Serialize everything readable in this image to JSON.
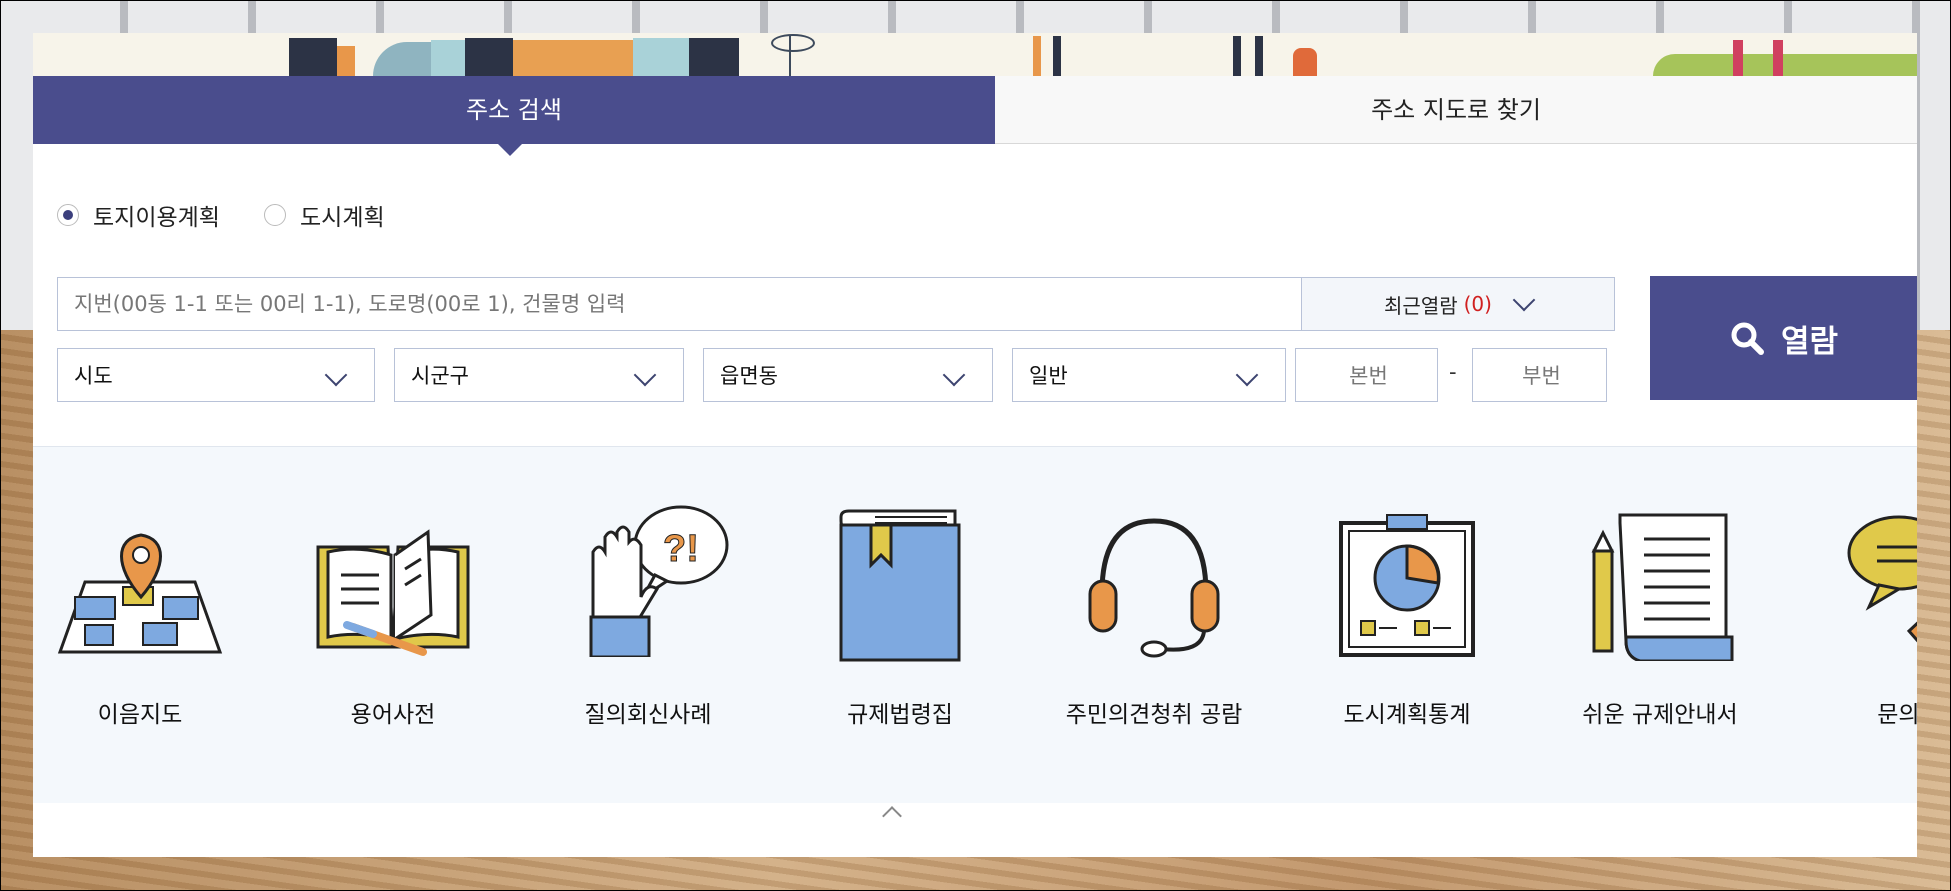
{
  "tabs": {
    "address_search": "주소 검색",
    "find_on_map": "주소 지도로 찾기"
  },
  "radio": {
    "land_use_plan": "토지이용계획",
    "city_plan": "도시계획",
    "selected": "토지이용계획"
  },
  "search": {
    "placeholder": "지번(00동 1-1 또는 00리 1-1), 도로명(00로 1), 건물명 입력",
    "value": ""
  },
  "recent": {
    "label": "최근열람",
    "count": "(0)"
  },
  "view_button": "열람",
  "selects": {
    "sido": "시도",
    "sigungu": "시군구",
    "eupmyeondong": "읍면동",
    "type": "일반"
  },
  "lot_number": {
    "main_placeholder": "본번",
    "separator": "-",
    "sub_placeholder": "부번"
  },
  "services": [
    {
      "label": "이음지도",
      "icon": "map-pin-icon"
    },
    {
      "label": "용어사전",
      "icon": "open-book-icon"
    },
    {
      "label": "질의회신사례",
      "icon": "hand-question-icon"
    },
    {
      "label": "규제법령집",
      "icon": "law-book-icon"
    },
    {
      "label": "주민의견청취 공람",
      "icon": "headset-icon"
    },
    {
      "label": "도시계획통계",
      "icon": "statistics-board-icon"
    },
    {
      "label": "쉬운 규제안내서",
      "icon": "guide-scroll-icon"
    },
    {
      "label": "문의처",
      "icon": "speech-bubble-phone-icon"
    }
  ],
  "colors": {
    "primary": "#4a4d8d",
    "accent_orange": "#e8974a",
    "accent_blue": "#7ea9e0",
    "accent_yellow": "#e0c94a",
    "count_red": "#d02020"
  }
}
